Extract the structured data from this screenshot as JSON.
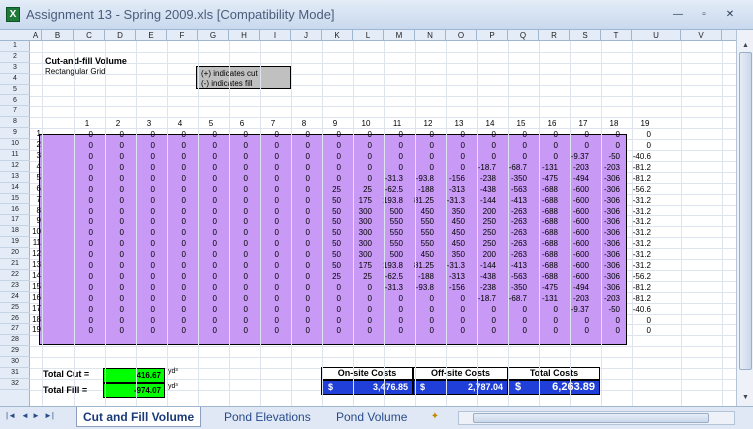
{
  "window": {
    "title": "Assignment 13 - Spring 2009.xls  [Compatibility Mode]",
    "app_icon_label": "X"
  },
  "window_controls": {
    "minimize": "—",
    "restore": "▫",
    "close": "✕"
  },
  "columns": [
    "A",
    "B",
    "C",
    "D",
    "E",
    "F",
    "G",
    "H",
    "I",
    "J",
    "K",
    "L",
    "M",
    "N",
    "O",
    "P",
    "Q",
    "R",
    "S",
    "T",
    "U",
    "V"
  ],
  "rows": [
    "1",
    "2",
    "3",
    "4",
    "5",
    "6",
    "7",
    "8",
    "9",
    "10",
    "11",
    "12",
    "13",
    "14",
    "15",
    "16",
    "17",
    "18",
    "19",
    "20",
    "21",
    "22",
    "23",
    "24",
    "25",
    "26",
    "27",
    "28",
    "29",
    "30",
    "31",
    "32"
  ],
  "sheet": {
    "heading": "Cut-and-fill Volume",
    "subheading": "Rectangular Grid",
    "legend": [
      "(+) indicates cut",
      "(-) indicates fill"
    ],
    "grid_col_numbers": [
      "1",
      "2",
      "3",
      "4",
      "5",
      "6",
      "7",
      "8",
      "9",
      "10",
      "11",
      "12",
      "13",
      "14",
      "15",
      "16",
      "17",
      "18",
      "19"
    ],
    "grid_row_numbers": [
      "1",
      "2",
      "3",
      "4",
      "5",
      "6",
      "7",
      "8",
      "9",
      "10",
      "11",
      "12",
      "13",
      "14",
      "15",
      "16",
      "17",
      "18",
      "19"
    ],
    "grid_values": [
      [
        "0",
        "0",
        "0",
        "0",
        "0",
        "0",
        "0",
        "0",
        "0",
        "0",
        "0",
        "0",
        "0",
        "0",
        "0",
        "0",
        "0",
        "0",
        "0"
      ],
      [
        "0",
        "0",
        "0",
        "0",
        "0",
        "0",
        "0",
        "0",
        "0",
        "0",
        "0",
        "0",
        "0",
        "0",
        "0",
        "0",
        "0",
        "0",
        "0"
      ],
      [
        "0",
        "0",
        "0",
        "0",
        "0",
        "0",
        "0",
        "0",
        "0",
        "0",
        "0",
        "0",
        "0",
        "0",
        "0",
        "0",
        "-9.37",
        "-50",
        "-40.6"
      ],
      [
        "0",
        "0",
        "0",
        "0",
        "0",
        "0",
        "0",
        "0",
        "0",
        "0",
        "0",
        "0",
        "0",
        "-18.7",
        "-68.7",
        "-131",
        "-203",
        "-203",
        "-81.2"
      ],
      [
        "0",
        "0",
        "0",
        "0",
        "0",
        "0",
        "0",
        "0",
        "0",
        "0",
        "-31.3",
        "-93.8",
        "-156",
        "-238",
        "-350",
        "-475",
        "-494",
        "-306",
        "-81.2"
      ],
      [
        "0",
        "0",
        "0",
        "0",
        "0",
        "0",
        "0",
        "0",
        "25",
        "25",
        "-62.5",
        "-188",
        "-313",
        "-438",
        "-563",
        "-688",
        "-600",
        "-306",
        "-56.2"
      ],
      [
        "0",
        "0",
        "0",
        "0",
        "0",
        "0",
        "0",
        "0",
        "50",
        "175",
        "193.8",
        "81.25",
        "-31.3",
        "-144",
        "-413",
        "-688",
        "-600",
        "-306",
        "-31.2"
      ],
      [
        "0",
        "0",
        "0",
        "0",
        "0",
        "0",
        "0",
        "0",
        "50",
        "300",
        "500",
        "450",
        "350",
        "200",
        "-263",
        "-688",
        "-600",
        "-306",
        "-31.2"
      ],
      [
        "0",
        "0",
        "0",
        "0",
        "0",
        "0",
        "0",
        "0",
        "50",
        "300",
        "550",
        "550",
        "450",
        "250",
        "-263",
        "-688",
        "-600",
        "-306",
        "-31.2"
      ],
      [
        "0",
        "0",
        "0",
        "0",
        "0",
        "0",
        "0",
        "0",
        "50",
        "300",
        "550",
        "550",
        "450",
        "250",
        "-263",
        "-688",
        "-600",
        "-306",
        "-31.2"
      ],
      [
        "0",
        "0",
        "0",
        "0",
        "0",
        "0",
        "0",
        "0",
        "50",
        "300",
        "550",
        "550",
        "450",
        "250",
        "-263",
        "-688",
        "-600",
        "-306",
        "-31.2"
      ],
      [
        "0",
        "0",
        "0",
        "0",
        "0",
        "0",
        "0",
        "0",
        "50",
        "300",
        "500",
        "450",
        "350",
        "200",
        "-263",
        "-688",
        "-600",
        "-306",
        "-31.2"
      ],
      [
        "0",
        "0",
        "0",
        "0",
        "0",
        "0",
        "0",
        "0",
        "50",
        "175",
        "193.8",
        "81.25",
        "-31.3",
        "-144",
        "-413",
        "-688",
        "-600",
        "-306",
        "-31.2"
      ],
      [
        "0",
        "0",
        "0",
        "0",
        "0",
        "0",
        "0",
        "0",
        "25",
        "25",
        "-62.5",
        "-188",
        "-313",
        "-438",
        "-563",
        "-688",
        "-600",
        "-306",
        "-56.2"
      ],
      [
        "0",
        "0",
        "0",
        "0",
        "0",
        "0",
        "0",
        "0",
        "0",
        "0",
        "-31.3",
        "-93.8",
        "-156",
        "-238",
        "-350",
        "-475",
        "-494",
        "-306",
        "-81.2"
      ],
      [
        "0",
        "0",
        "0",
        "0",
        "0",
        "0",
        "0",
        "0",
        "0",
        "0",
        "0",
        "0",
        "0",
        "-18.7",
        "-68.7",
        "-131",
        "-203",
        "-203",
        "-81.2"
      ],
      [
        "0",
        "0",
        "0",
        "0",
        "0",
        "0",
        "0",
        "0",
        "0",
        "0",
        "0",
        "0",
        "0",
        "0",
        "0",
        "0",
        "-9.37",
        "-50",
        "-40.6"
      ],
      [
        "0",
        "0",
        "0",
        "0",
        "0",
        "0",
        "0",
        "0",
        "0",
        "0",
        "0",
        "0",
        "0",
        "0",
        "0",
        "0",
        "0",
        "0",
        "0"
      ],
      [
        "0",
        "0",
        "0",
        "0",
        "0",
        "0",
        "0",
        "0",
        "0",
        "0",
        "0",
        "0",
        "0",
        "0",
        "0",
        "0",
        "0",
        "0",
        "0"
      ]
    ],
    "totals": {
      "cut_label": "Total Cut =",
      "cut_value": "416.67",
      "fill_label": "Total Fill =",
      "fill_value": "-974.07",
      "unit": "yd³"
    },
    "costs": {
      "headers": [
        "On-site Costs",
        "Off-site Costs",
        "Total Costs"
      ],
      "currency": "$",
      "values": [
        "3,476.85",
        "2,787.04",
        "6,263.89"
      ]
    }
  },
  "tabs": [
    "Cut and Fill Volume",
    "Pond Elevations",
    "Pond Volume"
  ],
  "tab_nav": {
    "first": "|◄",
    "prev": "◄",
    "next": "►",
    "last": "►|"
  },
  "scroll": {
    "up": "▲",
    "down": "▼"
  },
  "colors": {
    "grid_fill": "#c89af6",
    "total_fill": "#00ff00",
    "cost_fill": "#1f3fd8"
  }
}
